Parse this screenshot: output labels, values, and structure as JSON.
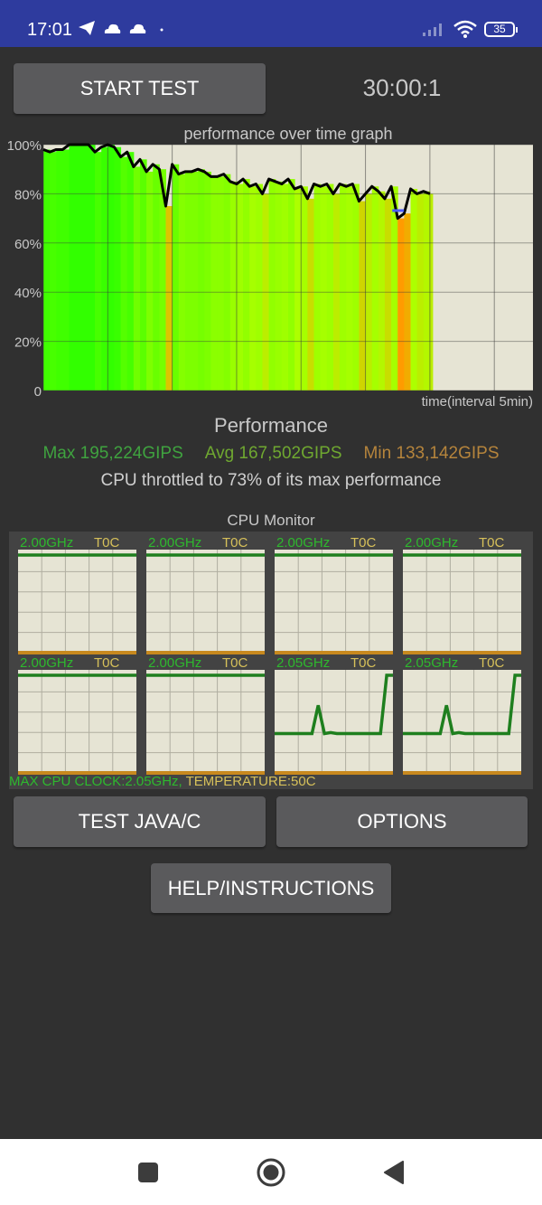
{
  "status_bar": {
    "time": "17:01",
    "left_icons": [
      "telegram-icon",
      "cloud-icon",
      "cloud-icon",
      "dot-icon"
    ],
    "right_icons": [
      "signal-icon",
      "wifi-icon",
      "battery-icon"
    ],
    "battery_level": "35"
  },
  "controls": {
    "start_test_label": "START TEST",
    "timer": "30:00:1",
    "test_java_c_label": "TEST JAVA/C",
    "options_label": "OPTIONS",
    "help_label": "HELP/INSTRUCTIONS"
  },
  "chart_data": {
    "type": "area",
    "title": "performance over time graph",
    "xlabel": "time(interval 5min)",
    "ylabel": "",
    "ytick_labels": [
      "100%",
      "80%",
      "60%",
      "40%",
      "20%",
      "0"
    ],
    "ylim": [
      0,
      100
    ],
    "xlim_minutes": [
      0,
      38
    ],
    "x_interval_minutes": 5,
    "grid": true,
    "series": [
      {
        "name": "performance",
        "x_minutes": [
          0,
          0.5,
          1,
          1.5,
          2,
          2.5,
          3,
          3.5,
          4,
          4.5,
          5,
          5.5,
          6,
          6.5,
          7,
          7.5,
          8,
          8.5,
          9,
          9.5,
          10,
          10.5,
          11,
          11.5,
          12,
          12.5,
          13,
          13.5,
          14,
          14.5,
          15,
          15.5,
          16,
          16.5,
          17,
          17.5,
          18,
          18.5,
          19,
          19.5,
          20,
          20.5,
          21,
          21.5,
          22,
          22.5,
          23,
          23.5,
          24,
          24.5,
          25,
          25.5,
          26,
          26.5,
          27,
          27.5,
          28,
          28.5,
          29,
          29.5,
          30
        ],
        "values": [
          98,
          97,
          98,
          98,
          100,
          100,
          100,
          100,
          97,
          99,
          100,
          99,
          95,
          97,
          91,
          94,
          89,
          92,
          90,
          75,
          92,
          88,
          89,
          89,
          90,
          89,
          87,
          87,
          88,
          85,
          84,
          86,
          83,
          84,
          80,
          86,
          85,
          84,
          86,
          82,
          83,
          78,
          84,
          83,
          84,
          80,
          84,
          83,
          84,
          77,
          80,
          83,
          81,
          78,
          83,
          70,
          72,
          82,
          80,
          81,
          80
        ]
      }
    ],
    "markers": [
      {
        "x_minutes": 27.5,
        "value": 73,
        "color": "#4b5bff"
      }
    ]
  },
  "performance": {
    "title": "Performance",
    "max": "Max 195,224GIPS",
    "avg": "Avg 167,502GIPS",
    "min": "Min 133,142GIPS",
    "throttle_text": "CPU throttled to 73% of its max performance",
    "colors": {
      "max": "#3fa33f",
      "avg": "#6fa830",
      "min": "#b5843c"
    }
  },
  "cpu_monitor": {
    "title": "CPU Monitor",
    "cores": [
      {
        "freq": "2.00GHz",
        "temp": "T0C",
        "history": [
          1,
          1,
          1,
          1,
          1,
          1,
          1,
          1,
          1,
          1,
          1,
          1,
          1,
          1,
          1,
          1,
          1,
          1,
          1,
          1
        ]
      },
      {
        "freq": "2.00GHz",
        "temp": "T0C",
        "history": [
          1,
          1,
          1,
          1,
          1,
          1,
          1,
          1,
          1,
          1,
          1,
          1,
          1,
          1,
          1,
          1,
          1,
          1,
          1,
          1
        ]
      },
      {
        "freq": "2.00GHz",
        "temp": "T0C",
        "history": [
          1,
          1,
          1,
          1,
          1,
          1,
          1,
          1,
          1,
          1,
          1,
          1,
          1,
          1,
          1,
          1,
          1,
          1,
          1,
          1
        ]
      },
      {
        "freq": "2.00GHz",
        "temp": "T0C",
        "history": [
          1,
          1,
          1,
          1,
          1,
          1,
          1,
          1,
          1,
          1,
          1,
          1,
          1,
          1,
          1,
          1,
          1,
          1,
          1,
          1
        ]
      },
      {
        "freq": "2.00GHz",
        "temp": "T0C",
        "history": [
          1,
          1,
          1,
          1,
          1,
          1,
          1,
          1,
          1,
          1,
          1,
          1,
          1,
          1,
          1,
          1,
          1,
          1,
          1,
          1
        ]
      },
      {
        "freq": "2.00GHz",
        "temp": "T0C",
        "history": [
          1,
          1,
          1,
          1,
          1,
          1,
          1,
          1,
          1,
          1,
          1,
          1,
          1,
          1,
          1,
          1,
          1,
          1,
          1,
          1
        ]
      },
      {
        "freq": "2.05GHz",
        "temp": "T0C",
        "history": [
          0.38,
          0.38,
          0.38,
          0.38,
          0.38,
          0.38,
          0.38,
          0.68,
          0.38,
          0.39,
          0.38,
          0.38,
          0.38,
          0.38,
          0.38,
          0.38,
          0.38,
          0.38,
          1,
          1
        ]
      },
      {
        "freq": "2.05GHz",
        "temp": "T0C",
        "history": [
          0.38,
          0.38,
          0.38,
          0.38,
          0.38,
          0.38,
          0.38,
          0.68,
          0.38,
          0.39,
          0.38,
          0.38,
          0.38,
          0.38,
          0.38,
          0.38,
          0.38,
          0.38,
          1,
          1
        ]
      }
    ],
    "footer_clock": "MAX CPU CLOCK:2.05GHz,",
    "footer_temp": " TEMPERATURE:50C"
  },
  "nav_bar": {
    "items": [
      "recents-icon",
      "home-icon",
      "back-icon"
    ]
  }
}
